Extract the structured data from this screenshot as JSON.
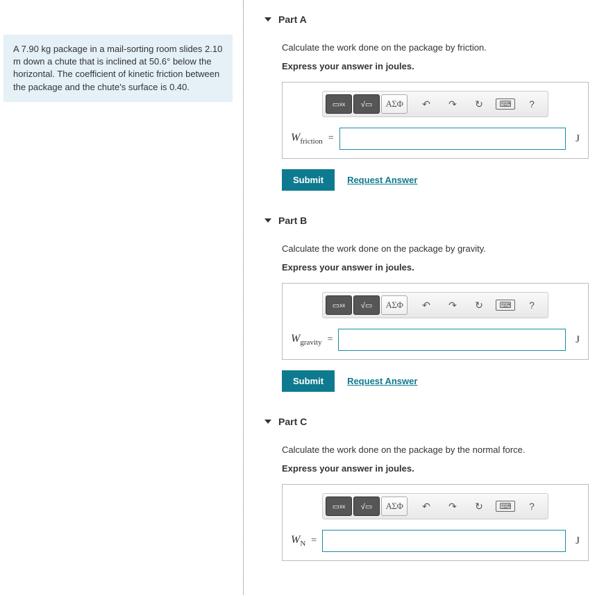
{
  "problem": {
    "text": "A 7.90 kg package in a mail-sorting room slides 2.10 m down a chute that is inclined at 50.6° below the horizontal. The coefficient of kinetic friction between the package and the chute's surface is 0.40."
  },
  "toolbar": {
    "template": "▭",
    "sqrt": "√▭",
    "greek": "ΑΣΦ",
    "undo": "↶",
    "redo": "↷",
    "reset": "↻",
    "keyboard": "⌨",
    "help": "?"
  },
  "common": {
    "equals": "=",
    "submit": "Submit",
    "request": "Request Answer"
  },
  "parts": {
    "A": {
      "title": "Part A",
      "instruction": "Calculate the work done on the package by friction.",
      "express": "Express your answer in joules.",
      "varMain": "W",
      "varSub": "friction",
      "unit": "J"
    },
    "B": {
      "title": "Part B",
      "instruction": "Calculate the work done on the package by gravity.",
      "express": "Express your answer in joules.",
      "varMain": "W",
      "varSub": "gravity",
      "unit": "J"
    },
    "C": {
      "title": "Part C",
      "instruction": "Calculate the work done on the package by the normal force.",
      "express": "Express your answer in joules.",
      "varMain": "W",
      "varSub": "N",
      "unit": "J"
    }
  }
}
